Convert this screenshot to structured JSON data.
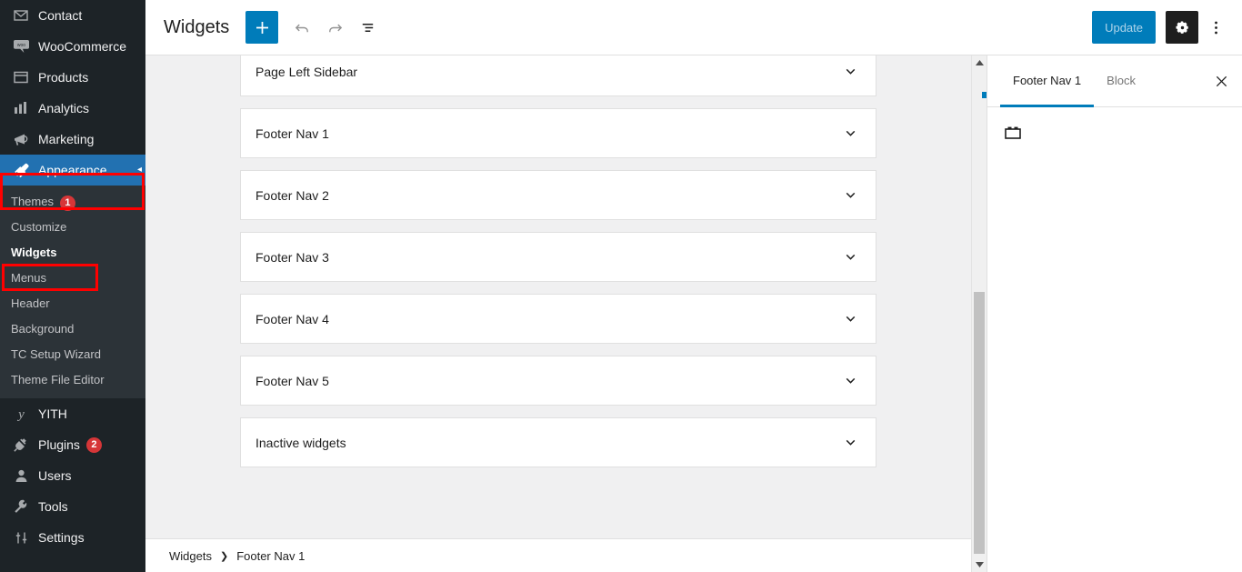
{
  "sidebar": {
    "items": [
      {
        "label": "Contact",
        "icon": "envelope-icon",
        "badge": null
      },
      {
        "label": "WooCommerce",
        "icon": "woocommerce-icon",
        "badge": null
      },
      {
        "label": "Products",
        "icon": "products-icon",
        "badge": null
      },
      {
        "label": "Analytics",
        "icon": "analytics-icon",
        "badge": null
      },
      {
        "label": "Marketing",
        "icon": "megaphone-icon",
        "badge": null
      },
      {
        "label": "Appearance",
        "icon": "paintbrush-icon",
        "badge": null,
        "current": true
      }
    ],
    "submenu": [
      {
        "label": "Themes",
        "badge": "1"
      },
      {
        "label": "Customize",
        "badge": null
      },
      {
        "label": "Widgets",
        "badge": null,
        "current": true
      },
      {
        "label": "Menus",
        "badge": null
      },
      {
        "label": "Header",
        "badge": null
      },
      {
        "label": "Background",
        "badge": null
      },
      {
        "label": "TC Setup Wizard",
        "badge": null
      },
      {
        "label": "Theme File Editor",
        "badge": null
      }
    ],
    "items_after": [
      {
        "label": "YITH",
        "icon": "yith-icon",
        "badge": null
      },
      {
        "label": "Plugins",
        "icon": "plug-icon",
        "badge": "2"
      },
      {
        "label": "Users",
        "icon": "users-icon",
        "badge": null
      },
      {
        "label": "Tools",
        "icon": "wrench-icon",
        "badge": null
      },
      {
        "label": "Settings",
        "icon": "settings-icon",
        "badge": null
      }
    ]
  },
  "toolbar": {
    "title": "Widgets",
    "add_label": "+",
    "add_name": "Add block",
    "undo_name": "Undo",
    "redo_name": "Redo",
    "list_view_name": "List View",
    "update_label": "Update",
    "settings_name": "Settings",
    "options_name": "Options"
  },
  "canvas": {
    "widget_areas": [
      {
        "title": "Page Left Sidebar"
      },
      {
        "title": "Footer Nav 1"
      },
      {
        "title": "Footer Nav 2"
      },
      {
        "title": "Footer Nav 3"
      },
      {
        "title": "Footer Nav 4"
      },
      {
        "title": "Footer Nav 5"
      },
      {
        "title": "Inactive widgets"
      }
    ]
  },
  "breadcrumb": {
    "root": "Widgets",
    "separator": "›",
    "current": "Footer Nav 1"
  },
  "inspector": {
    "tabs": [
      {
        "label": "Footer Nav 1",
        "active": true
      },
      {
        "label": "Block",
        "active": false
      }
    ],
    "close_label": "✕",
    "block_icon": "widget-block-icon"
  },
  "scrollbar": {
    "up_arrow": "▲",
    "down_arrow": "▼"
  },
  "colors": {
    "admin_bg": "#1d2327",
    "submenu_bg": "#2c3338",
    "accent_blue": "#2271b1",
    "button_blue": "#007cba",
    "badge_red": "#d63638",
    "annotation_red": "#ff0000",
    "canvas_bg": "#f0f0f1"
  }
}
